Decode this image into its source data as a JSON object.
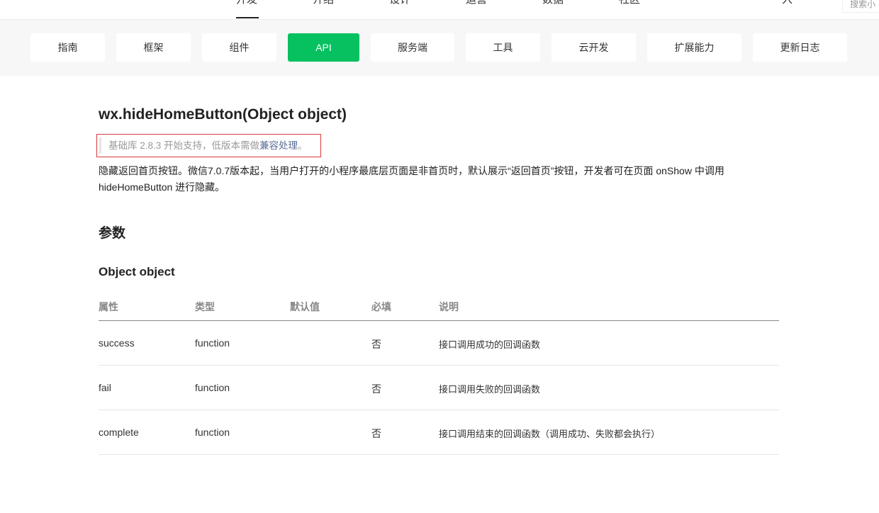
{
  "topnav": {
    "items": [
      "开发",
      "介绍",
      "设计",
      "运营",
      "数据",
      "社区"
    ],
    "right_item": "入",
    "search_placeholder": "搜索小"
  },
  "categories": [
    {
      "label": "指南",
      "active": false
    },
    {
      "label": "框架",
      "active": false
    },
    {
      "label": "组件",
      "active": false
    },
    {
      "label": "API",
      "active": true
    },
    {
      "label": "服务端",
      "active": false
    },
    {
      "label": "工具",
      "active": false
    },
    {
      "label": "云开发",
      "active": false
    },
    {
      "label": "扩展能力",
      "active": false
    },
    {
      "label": "更新日志",
      "active": false
    }
  ],
  "accent_color": "#07c160",
  "highlight_border_color": "#d9373f",
  "content": {
    "title": "wx.hideHomeButton(Object object)",
    "support_prefix": "基础库 2.8.3 开始支持，低版本需做",
    "support_link": "兼容处理",
    "support_suffix": "。",
    "description": "隐藏返回首页按钮。微信7.0.7版本起，当用户打开的小程序最底层页面是非首页时，默认展示“返回首页”按钮，开发者可在页面 onShow 中调用 hideHomeButton 进行隐藏。",
    "params_heading": "参数",
    "object_heading": "Object object",
    "table": {
      "headers": [
        "属性",
        "类型",
        "默认值",
        "必填",
        "说明"
      ],
      "rows": [
        [
          "success",
          "function",
          "",
          "否",
          "接口调用成功的回调函数"
        ],
        [
          "fail",
          "function",
          "",
          "否",
          "接口调用失败的回调函数"
        ],
        [
          "complete",
          "function",
          "",
          "否",
          "接口调用结束的回调函数（调用成功、失败都会执行）"
        ]
      ]
    }
  }
}
